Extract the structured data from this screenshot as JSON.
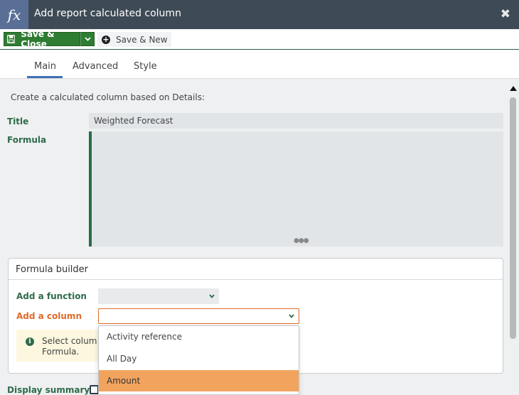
{
  "window": {
    "title": "Add report calculated column",
    "logo_text": "fx",
    "close_icon": "close-icon"
  },
  "toolbar": {
    "save_close_label": "Save & Close",
    "save_new_label": "Save & New"
  },
  "tabs": [
    {
      "label": "Main",
      "active": true
    },
    {
      "label": "Advanced",
      "active": false
    },
    {
      "label": "Style",
      "active": false
    }
  ],
  "main": {
    "intro": "Create a calculated column based on Details:",
    "title_label": "Title",
    "title_value": "Weighted Forecast",
    "formula_label": "Formula",
    "formula_value": ""
  },
  "builder": {
    "header": "Formula builder",
    "add_function_label": "Add a function",
    "add_function_value": "",
    "add_column_label": "Add a column",
    "add_column_value": "",
    "info_line1": "Select colum",
    "info_line2": "Formula."
  },
  "display_summary": {
    "label": "Display summary",
    "checked": false
  },
  "column_dropdown": {
    "options": [
      "Activity reference",
      "All Day",
      "Amount"
    ],
    "highlighted": "Amount"
  },
  "colors": {
    "titlebar": "#3e4a55",
    "save_green": "#2e7d32",
    "accent_orange": "#e06a2a",
    "highlight": "#f2a45f",
    "label_green": "#2f6b4a"
  }
}
